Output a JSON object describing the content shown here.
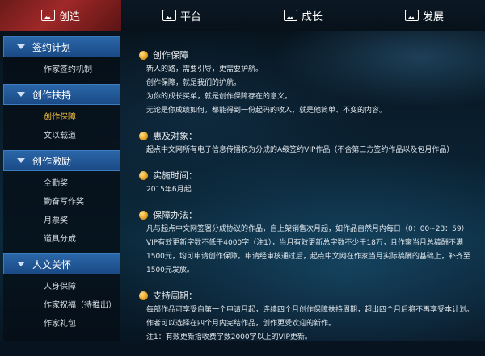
{
  "nav": {
    "items": [
      {
        "label": "创造"
      },
      {
        "label": "平台"
      },
      {
        "label": "成长"
      },
      {
        "label": "发展"
      }
    ]
  },
  "sidebar": {
    "sections": [
      {
        "title": "签约计划",
        "items": [
          "作家签约机制"
        ]
      },
      {
        "title": "创作扶持",
        "items": [
          "创作保障",
          "文以载道"
        ],
        "active": "创作保障"
      },
      {
        "title": "创作激励",
        "items": [
          "全勤奖",
          "勤奋写作奖",
          "月票奖",
          "道具分成"
        ]
      },
      {
        "title": "人文关怀",
        "items": [
          "人身保障",
          "作家祝福（待推出）",
          "作家礼包"
        ]
      }
    ]
  },
  "main": {
    "sections": [
      {
        "title": "创作保障",
        "lines": [
          "新人的路，需要引导，更需要护航。",
          "创作保障，就是我们的护航。",
          "为你的成长买单，就是创作保障存在的意义。",
          "无论是你成绩如何，都能得到一份起码的收入，就是他简单、不变的内容。"
        ]
      },
      {
        "title": "惠及对象：",
        "lines": [
          "起点中文网所有电子信息传播权为分成的A级签约VIP作品（不含第三方签约作品以及包月作品）"
        ]
      },
      {
        "title": "实施时间：",
        "lines": [
          "2015年6月起"
        ]
      },
      {
        "title": "保障办法：",
        "lines": [
          "凡与起点中文网签署分成协议的作品，自上架销售次月起，如作品自然月内每日（0：00~23：59）VIP有效更新字数不低于4000字（注1），当月有效更新总字数不少于18万，且作家当月总稿酬不满1500元，均可申请创作保障。申请经审核通过后，起点中文网在作家当月实际稿酬的基础上，补齐至1500元发放。"
        ]
      },
      {
        "title": "支持周期：",
        "lines": [
          "每部作品可享受自第一个申请月起，连续四个月创作保障扶持周期，超出四个月后将不再享受本计划。作者可以选择在四个月内完结作品，创作更受欢迎的新作。",
          "注1：有效更新指收费字数2000字以上的VIP更新。"
        ]
      }
    ]
  }
}
